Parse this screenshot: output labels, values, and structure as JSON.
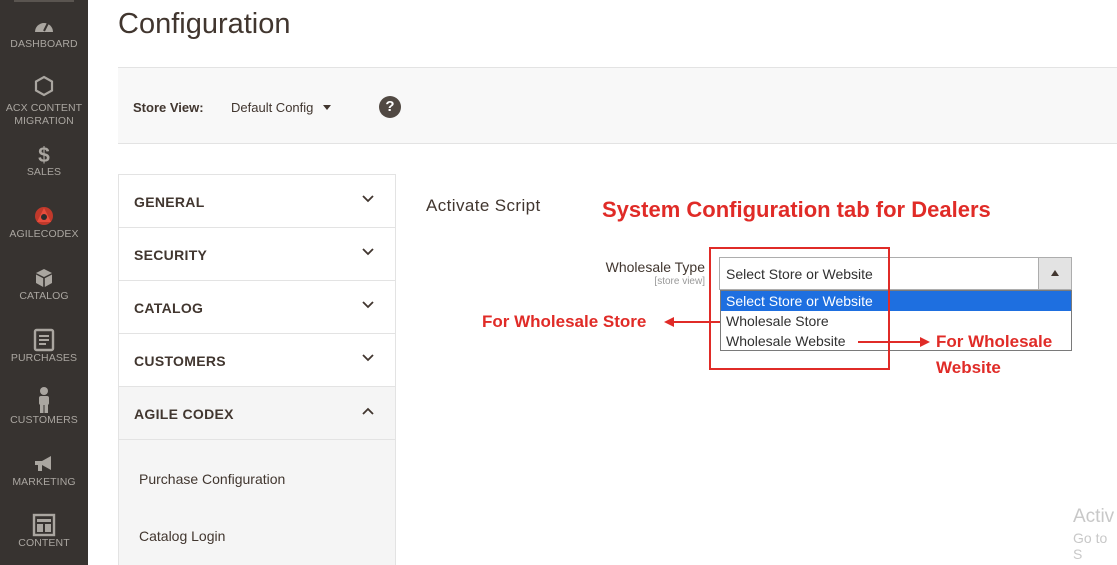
{
  "nav": {
    "items": [
      {
        "label": "DASHBOARD",
        "icon": "dashboard-icon"
      },
      {
        "label": "ACX CONTENT MIGRATION",
        "icon": "hexagon-icon"
      },
      {
        "label": "SALES",
        "icon": "dollar-icon"
      },
      {
        "label": "AGILECODEX",
        "icon": "agilecodex-logo-icon"
      },
      {
        "label": "CATALOG",
        "icon": "box-icon"
      },
      {
        "label": "PURCHASES",
        "icon": "document-icon"
      },
      {
        "label": "CUSTOMERS",
        "icon": "person-icon"
      },
      {
        "label": "MARKETING",
        "icon": "megaphone-icon"
      },
      {
        "label": "CONTENT",
        "icon": "layout-icon"
      }
    ]
  },
  "page": {
    "title": "Configuration"
  },
  "store_view": {
    "label": "Store View:",
    "value": "Default Config",
    "help_icon": "?"
  },
  "tabs": [
    {
      "label": "GENERAL",
      "state": "collapsed"
    },
    {
      "label": "SECURITY",
      "state": "collapsed"
    },
    {
      "label": "CATALOG",
      "state": "collapsed"
    },
    {
      "label": "CUSTOMERS",
      "state": "collapsed"
    },
    {
      "label": "AGILE CODEX",
      "state": "expanded"
    }
  ],
  "submenu": [
    "Purchase Configuration",
    "Catalog Login"
  ],
  "section": {
    "title": "Activate Script"
  },
  "field": {
    "label": "Wholesale Type",
    "scope": "[store view]",
    "value": "Select Store or Website",
    "options": [
      "Select Store or Website",
      "Wholesale Store",
      "Wholesale Website"
    ]
  },
  "annotations": {
    "title": "System Configuration tab for Dealers",
    "store": "For Wholesale Store",
    "website_line1": "For Wholesale",
    "website_line2": "Website",
    "color": "#e02b27"
  },
  "watermark": {
    "line1": "Activ",
    "line2": "Go to S"
  },
  "colors": {
    "nav_bg": "#373330",
    "selected_option": "#1e6fe0",
    "annotation_red": "#e02b27"
  }
}
